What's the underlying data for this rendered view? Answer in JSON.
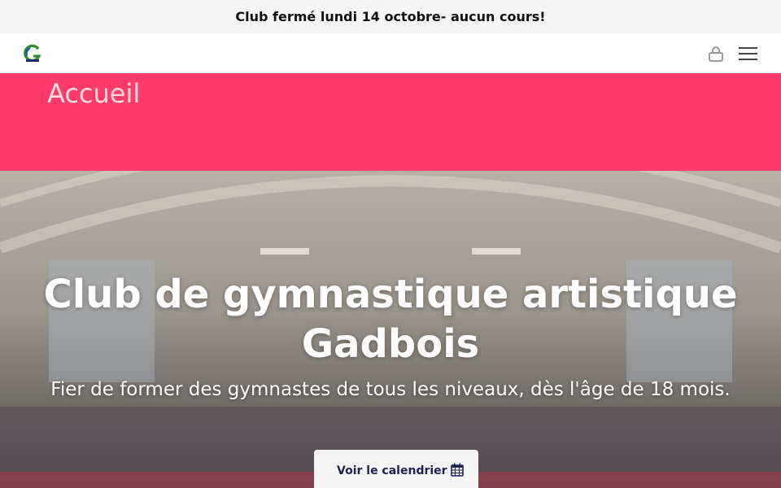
{
  "announcement": {
    "text": "Club fermé lundi 14 octobre- aucun cours!"
  },
  "header": {
    "logo_icon": "gadbois-logo-icon",
    "account_icon": "user-account-icon",
    "menu_icon": "hamburger-menu-icon"
  },
  "page": {
    "title": "Accueil"
  },
  "hero": {
    "title": "Club de gymnastique artistique Gadbois",
    "subtitle": "Fier de former des gymnastes de tous les niveaux, dès l'âge de 18 mois.",
    "cta_label": "Voir le calendrier",
    "cta_icon": "calendar-icon"
  },
  "colors": {
    "pink_band": "#ff3b6b",
    "cta_text": "#1e2353",
    "announce_bg": "#f5f5f5"
  }
}
